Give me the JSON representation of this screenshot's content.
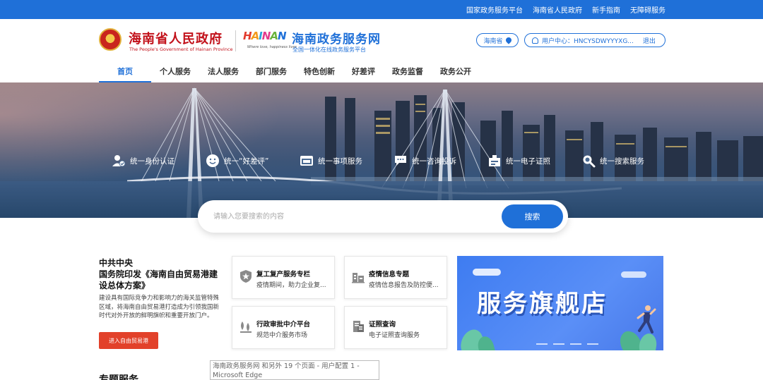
{
  "topbar": {
    "links": [
      "国家政务服务平台",
      "海南省人民政府",
      "新手指南",
      "无障碍服务"
    ]
  },
  "header": {
    "gov_name": "海南省人民政府",
    "gov_sub": "The People's Government of Hainan Province",
    "logo_word": "HAINAN",
    "logo_tag": "Where love, happiness lives",
    "svc_name": "海南政务服务网",
    "svc_sub": "全国一体化在线政务服务平台",
    "region": "海南省",
    "user_label": "用户中心：HNCYSDWYYYXG...",
    "logout": "退出"
  },
  "nav": {
    "items": [
      "首页",
      "个人服务",
      "法人服务",
      "部门服务",
      "特色创新",
      "好差评",
      "政务监督",
      "政务公开"
    ]
  },
  "banner": {
    "features": [
      {
        "label": "统一身份认证",
        "icon": "user-check-icon"
      },
      {
        "label": "统一“好差评”",
        "icon": "smile-icon"
      },
      {
        "label": "统一事项服务",
        "icon": "window-icon"
      },
      {
        "label": "统一咨询投诉",
        "icon": "chat-icon"
      },
      {
        "label": "统一电子证照",
        "icon": "license-icon"
      },
      {
        "label": "统一搜索服务",
        "icon": "search-icon"
      }
    ]
  },
  "search": {
    "placeholder": "请输入您要搜索的内容",
    "button": "搜索"
  },
  "article": {
    "title1": "中共中央",
    "title2": "国务院印发《海南自由贸易港建设总体方案》",
    "desc": "建设具有国际竞争力和影响力的海关监管特殊区域，将海南自由贸易港打造成为引领我国新时代对外开放的鲜明旗帜和重要开放门户。",
    "button": "进入自由贸易港"
  },
  "cards": [
    {
      "title": "复工复产服务专栏",
      "sub": "疫情期间，助力企业复...",
      "icon": "shield-icon"
    },
    {
      "title": "疫情信息专题",
      "sub": "疫情信息报告及防控便...",
      "icon": "building-icon"
    },
    {
      "title": "行政审批中介平台",
      "sub": "规范中介服务市场",
      "icon": "scale-icon"
    },
    {
      "title": "证照查询",
      "sub": "电子证照查询服务",
      "icon": "document-icon"
    }
  ],
  "flagship": {
    "text": "服务旗舰店"
  },
  "section": {
    "title": "专题服务"
  },
  "tooltip": {
    "text": "海南政务服务网 和另外 19 个页面 - 用户配置 1 - Microsoft Edge"
  }
}
